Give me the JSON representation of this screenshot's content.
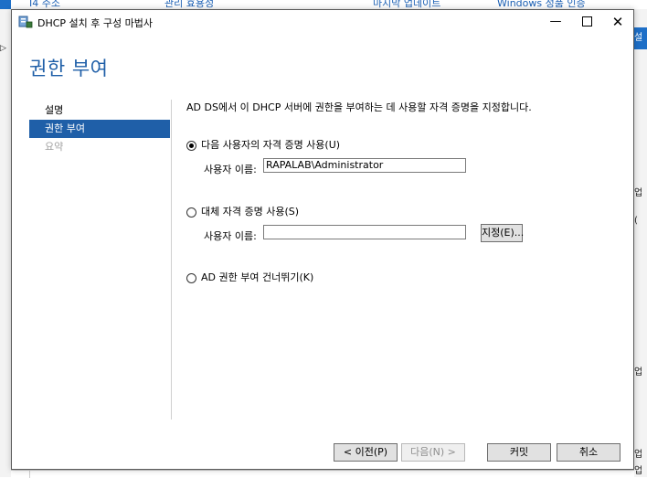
{
  "background": {
    "top_fragments": [
      "I4 주소",
      "관리 효용성",
      "마지막 업데이트",
      "Windows 정품 인증"
    ],
    "right_fragments": [
      "설정",
      "업",
      "(",
      "업",
      "업",
      "업"
    ]
  },
  "dialog": {
    "title": "DHCP 설치 후 구성 마법사",
    "page_title": "권한 부여",
    "nav": [
      {
        "label": "설명",
        "state": "normal"
      },
      {
        "label": "권한 부여",
        "state": "active"
      },
      {
        "label": "요약",
        "state": "disabled"
      }
    ],
    "description": "AD DS에서 이 DHCP 서버에 권한을 부여하는 데 사용할 자격 증명을 지정합니다.",
    "option1": {
      "label": "다음 사용자의 자격 증명 사용(U)",
      "selected": true,
      "user_label": "사용자 이름:",
      "user_value": "RAPALAB\\Administrator"
    },
    "option2": {
      "label": "대체 자격 증명 사용(S)",
      "selected": false,
      "user_label": "사용자 이름:",
      "user_value": "",
      "specify_button": "지정(E)..."
    },
    "option3": {
      "label": "AD 권한 부여 건너뛰기(K)",
      "selected": false
    },
    "buttons": {
      "prev": "< 이전(P)",
      "next": "다음(N) >",
      "commit": "커밋",
      "cancel": "취소"
    }
  }
}
